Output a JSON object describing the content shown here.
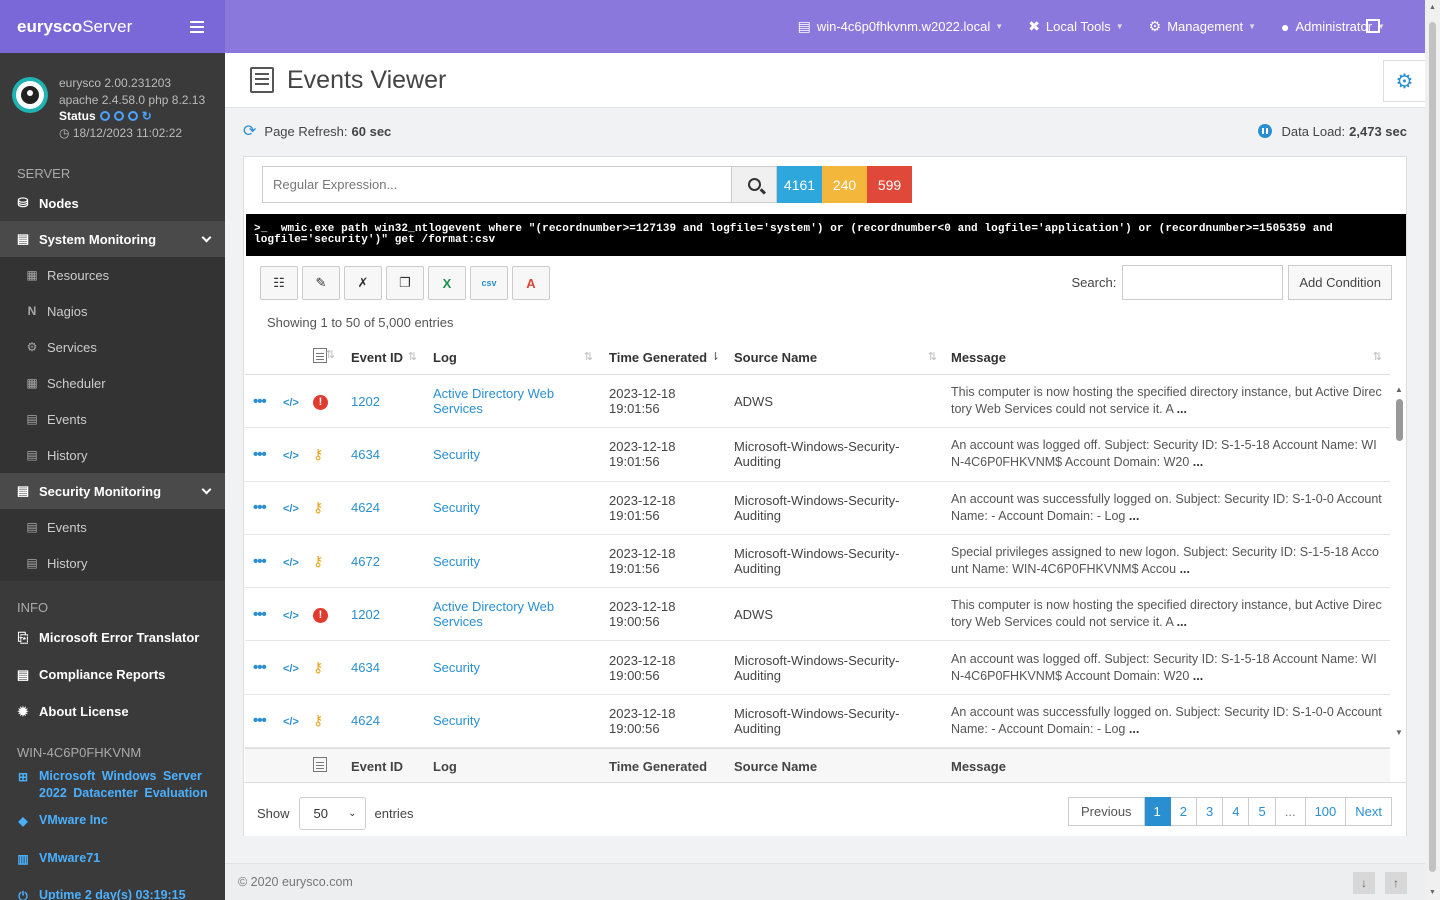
{
  "brand": {
    "name_bold": "eurysco",
    "name_rest": "Server"
  },
  "profile": {
    "version": "eurysco 2.00.231203",
    "stack": "apache 2.4.58.0  php 8.2.13",
    "status_label": "Status",
    "datetime": "18/12/2023 11:02:22"
  },
  "sidebar": {
    "server_header": "SERVER",
    "nodes": "Nodes",
    "system_monitoring": "System Monitoring",
    "system_items": [
      {
        "label": "Resources",
        "icon": "chart-icon"
      },
      {
        "label": "Nagios",
        "icon": "nagios-icon"
      },
      {
        "label": "Services",
        "icon": "gear-icon"
      },
      {
        "label": "Scheduler",
        "icon": "calendar-icon"
      },
      {
        "label": "Events",
        "icon": "list-icon"
      },
      {
        "label": "History",
        "icon": "list-icon"
      }
    ],
    "security_monitoring": "Security Monitoring",
    "security_items": [
      {
        "label": "Events",
        "icon": "list-icon"
      },
      {
        "label": "History",
        "icon": "list-icon"
      }
    ],
    "info_header": "INFO",
    "info_items": [
      {
        "label": "Microsoft Error Translator",
        "icon": "translate-icon"
      },
      {
        "label": "Compliance Reports",
        "icon": "report-icon"
      },
      {
        "label": "About License",
        "icon": "certificate-icon"
      }
    ],
    "host_header": "WIN-4C6P0FHKVNM",
    "host_items": [
      {
        "label": "Microsoft  Windows  Server 2022  Datacenter  Evaluation",
        "icon": "windows-icon"
      },
      {
        "label": "VMware Inc",
        "icon": "tag-icon"
      },
      {
        "label": "VMware71",
        "icon": "barcode-icon"
      },
      {
        "label": "Uptime 2 day(s) 03:19:15",
        "icon": "power-icon"
      }
    ]
  },
  "topbar": {
    "host": "win-4c6p0fhkvnm.w2022.local",
    "local_tools": "Local Tools",
    "management": "Management",
    "user": "Administrator"
  },
  "page": {
    "title": "Events Viewer",
    "refresh_label": "Page Refresh:",
    "refresh_value": "60 sec",
    "dataload_label": "Data Load:",
    "dataload_value": "2,473 sec"
  },
  "filter": {
    "placeholder": "Regular Expression...",
    "counts": [
      {
        "value": "4161",
        "color": "#2ea8dc"
      },
      {
        "value": "240",
        "color": "#f3b73b"
      },
      {
        "value": "599",
        "color": "#e0483a"
      }
    ]
  },
  "command": {
    "prompt": ">_",
    "text": "wmic.exe path win32_ntlogevent where \"(recordnumber>=127139 and logfile='system') or (recordnumber<0 and logfile='application') or (recordnumber>=1505359 and logfile='security')\" get /format:csv"
  },
  "table_controls": {
    "search_label": "Search:",
    "add_condition": "Add Condition",
    "showing": "Showing 1 to 50 of 5,000 entries"
  },
  "columns": [
    "Event ID",
    "Log",
    "Time Generated",
    "Source Name",
    "Message"
  ],
  "rows": [
    {
      "level": "error",
      "event_id": "1202",
      "log": "Active Directory Web Services",
      "time": "2023-12-18 19:01:56",
      "source": "ADWS",
      "message": "This computer is now hosting the specified directory instance, but Active Directory Web Services could not service it. A"
    },
    {
      "level": "audit",
      "event_id": "4634",
      "log": "Security",
      "time": "2023-12-18 19:01:56",
      "source": "Microsoft-Windows-Security-Auditing",
      "message": "An account was logged off. Subject: Security ID: S-1-5-18 Account Name: WIN-4C6P0FHKVNM$ Account Domain: W20"
    },
    {
      "level": "audit",
      "event_id": "4624",
      "log": "Security",
      "time": "2023-12-18 19:01:56",
      "source": "Microsoft-Windows-Security-Auditing",
      "message": "An account was successfully logged on. Subject: Security ID: S-1-0-0 Account Name: - Account Domain: - Log"
    },
    {
      "level": "audit",
      "event_id": "4672",
      "log": "Security",
      "time": "2023-12-18 19:01:56",
      "source": "Microsoft-Windows-Security-Auditing",
      "message": "Special privileges assigned to new logon. Subject: Security ID: S-1-5-18 Account Name: WIN-4C6P0FHKVNM$ Accou"
    },
    {
      "level": "error",
      "event_id": "1202",
      "log": "Active Directory Web Services",
      "time": "2023-12-18 19:00:56",
      "source": "ADWS",
      "message": "This computer is now hosting the specified directory instance, but Active Directory Web Services could not service it. A"
    },
    {
      "level": "audit",
      "event_id": "4634",
      "log": "Security",
      "time": "2023-12-18 19:00:56",
      "source": "Microsoft-Windows-Security-Auditing",
      "message": "An account was logged off. Subject: Security ID: S-1-5-18 Account Name: WIN-4C6P0FHKVNM$ Account Domain: W20"
    },
    {
      "level": "audit",
      "event_id": "4624",
      "log": "Security",
      "time": "2023-12-18 19:00:56",
      "source": "Microsoft-Windows-Security-Auditing",
      "message": "An account was successfully logged on. Subject: Security ID: S-1-0-0 Account Name: - Account Domain: - Log"
    }
  ],
  "message_ellipsis": "...",
  "length": {
    "show": "Show",
    "value": "50",
    "entries": "entries"
  },
  "pagination": [
    "Previous",
    "1",
    "2",
    "3",
    "4",
    "5",
    "...",
    "100",
    "Next"
  ],
  "pagination_active": "1",
  "footer": {
    "text": "© 2020   eurysco.com"
  }
}
